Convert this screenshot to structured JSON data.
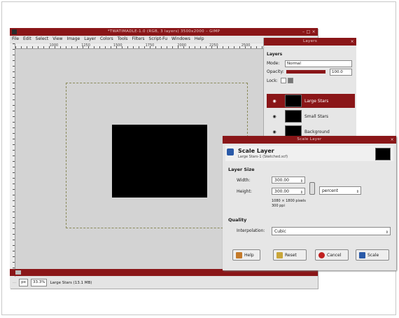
{
  "gimp_window": {
    "title": "*TWATIMADLE-1.0 (RGB, 3 layers) 3500x2000 – GIMP",
    "window_controls": "– □ ×",
    "menu": [
      "File",
      "Edit",
      "Select",
      "View",
      "Image",
      "Layer",
      "Colors",
      "Tools",
      "Filters",
      "Script-Fu",
      "Windows",
      "Help"
    ],
    "ruler_marks": [
      "1000",
      "1250",
      "1500",
      "1750",
      "2000",
      "2250",
      "2500"
    ],
    "status": {
      "units": "px",
      "zoom": "33.3%",
      "message": "Large Stars (13.1 MB)"
    }
  },
  "layers_panel": {
    "title": "Layers",
    "heading": "Layers",
    "mode_label": "Mode:",
    "mode_value": "Normal",
    "opacity_label": "Opacity:",
    "opacity_value": "100.0",
    "lock_label": "Lock:",
    "layers": [
      {
        "name": "Large Stars",
        "selected": true
      },
      {
        "name": "Small Stars",
        "selected": false
      },
      {
        "name": "Background",
        "selected": false
      }
    ]
  },
  "scale_dialog": {
    "window_title": "Scale Layer",
    "title": "Scale Layer",
    "subtitle": "Large Stars-1 (Sketched.xcf)",
    "layer_size_heading": "Layer Size",
    "width_label": "Width:",
    "width_value": "300.00",
    "height_label": "Height:",
    "height_value": "300.00",
    "unit": "percent",
    "size_info": "1080 × 1800 pixels",
    "ppi_info": "300 ppi",
    "quality_heading": "Quality",
    "interpolation_label": "Interpolation:",
    "interpolation_value": "Cubic",
    "buttons": {
      "help": "Help",
      "reset": "Reset",
      "cancel": "Cancel",
      "scale": "Scale"
    }
  }
}
